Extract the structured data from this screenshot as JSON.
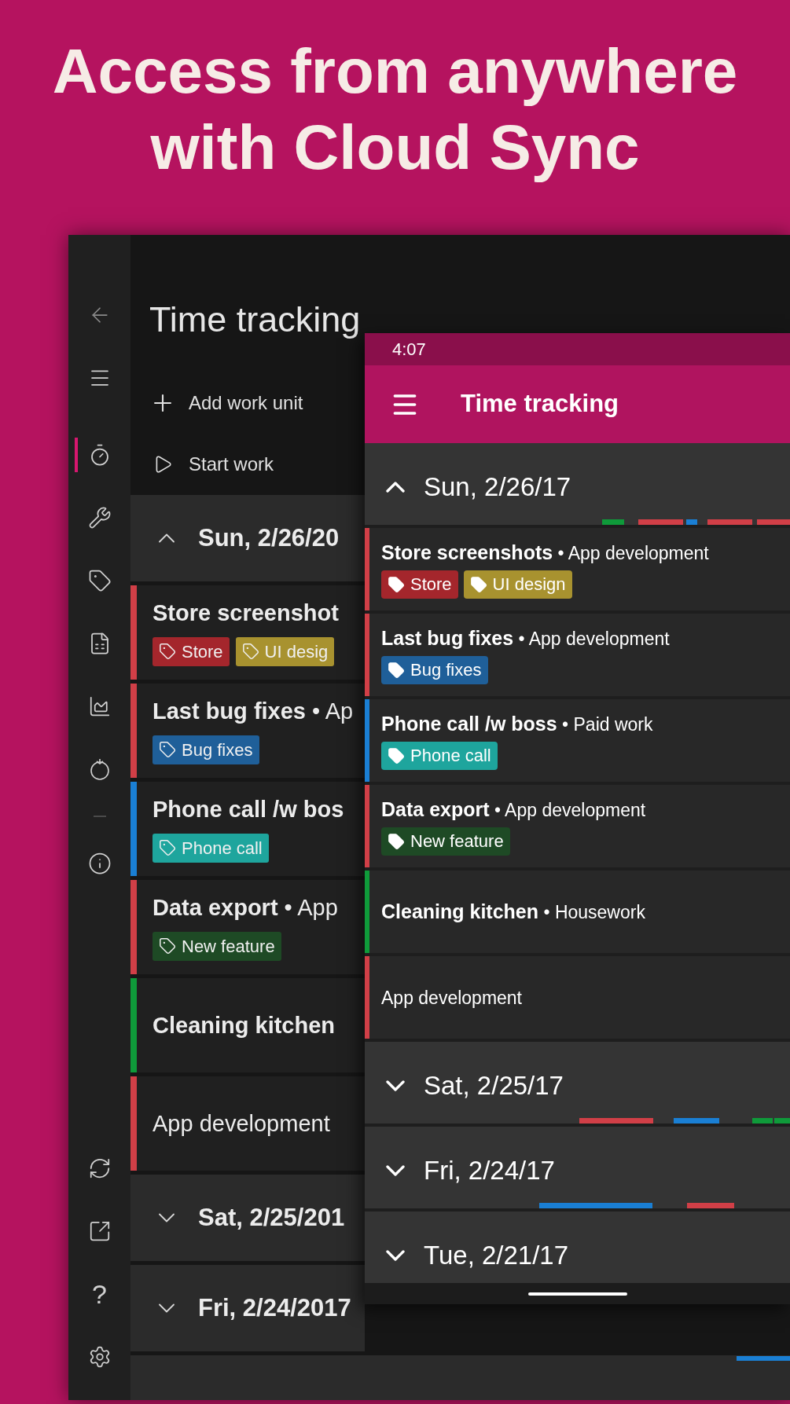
{
  "headline": [
    "Access from anywhere",
    "with Cloud Sync"
  ],
  "desktop": {
    "sidebar": {
      "items": [
        {
          "kind": "back",
          "selected": false
        },
        {
          "kind": "menu",
          "selected": false
        },
        {
          "kind": "timer",
          "selected": true
        },
        {
          "kind": "tools",
          "selected": false
        },
        {
          "kind": "tags",
          "selected": false
        },
        {
          "kind": "excel",
          "selected": false
        },
        {
          "kind": "chart",
          "selected": false
        },
        {
          "kind": "tomato",
          "selected": false
        },
        {
          "kind": "info",
          "selected": false
        },
        {
          "kind": "sync",
          "selected": false
        },
        {
          "kind": "share",
          "selected": false
        },
        {
          "kind": "help",
          "glyph": "?",
          "selected": false
        },
        {
          "kind": "settings",
          "selected": false
        }
      ]
    },
    "title": "Time tracking",
    "commands": [
      {
        "kind": "add",
        "label": "Add work unit"
      },
      {
        "kind": "start",
        "label": "Start work"
      }
    ],
    "days": [
      {
        "label": "Sun, 2/26/20",
        "expanded": true,
        "entries": [
          {
            "text": "**Store screenshot**",
            "color": "#d13f47",
            "tags": [
              {
                "label": "Store",
                "color": "#a4262c"
              },
              {
                "label": "UI desig",
                "color": "#a8922f"
              }
            ]
          },
          {
            "text": "**Last bug fixes** • Ap",
            "color": "#d13f47",
            "tags": [
              {
                "label": "Bug fixes",
                "color": "#1f5f99"
              }
            ]
          },
          {
            "text": "**Phone call /w bos**",
            "color": "#1a7fd4",
            "tags": [
              {
                "label": "Phone call",
                "color": "#1ea59d"
              }
            ]
          },
          {
            "text": "**Data export** • App",
            "color": "#d13f47",
            "tags": [
              {
                "label": "New feature",
                "color": "#1e4a25"
              }
            ]
          },
          {
            "text": "**Cleaning kitchen**",
            "color": "#0f9a3a"
          },
          {
            "text": "App development",
            "color": "#d13f47"
          }
        ]
      },
      {
        "label": "Sat, 2/25/201",
        "expanded": false
      },
      {
        "label": "Fri, 2/24/2017",
        "expanded": false
      }
    ]
  },
  "phone": {
    "status_time": "4:07",
    "title": "Time tracking",
    "days": [
      {
        "label": "Sun, 2/26/17",
        "expanded": true,
        "entries": [
          {
            "text": "**Store screenshots** • App development",
            "color": "#d13f47",
            "tags": [
              {
                "label": "Store",
                "color": "#a4262c"
              },
              {
                "label": "UI design",
                "color": "#a8922f"
              }
            ]
          },
          {
            "text": "**Last bug fixes** • App development",
            "color": "#d13f47",
            "tags": [
              {
                "label": "Bug fixes",
                "color": "#1f5f99"
              }
            ]
          },
          {
            "text": "**Phone call /w boss** • Paid work",
            "color": "#1a7fd4",
            "tags": [
              {
                "label": "Phone call",
                "color": "#1ea59d"
              }
            ]
          },
          {
            "text": "**Data export** • App development",
            "color": "#d13f47",
            "tags": [
              {
                "label": "New feature",
                "color": "#1e4a25"
              }
            ]
          },
          {
            "text": "**Cleaning kitchen** • Housework",
            "color": "#0f9a3a"
          },
          {
            "text": "App development",
            "color": "#d13f47"
          }
        ]
      },
      {
        "label": "Sat, 2/25/17",
        "expanded": false
      },
      {
        "label": "Fri, 2/24/17",
        "expanded": false
      },
      {
        "label": "Tue, 2/21/17",
        "expanded": false
      }
    ]
  }
}
